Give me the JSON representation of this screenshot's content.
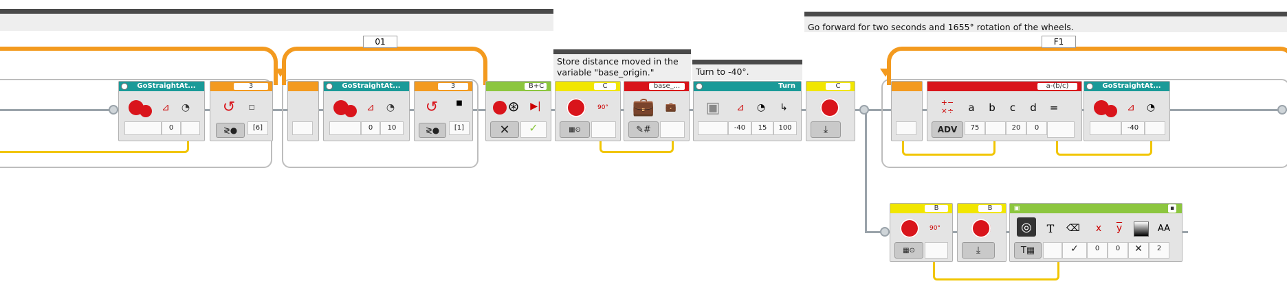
{
  "comments": {
    "c1": "",
    "c2": "Store distance moved in the variable \"base_origin.\"",
    "c3": "Turn to -40°.",
    "c4": "Go forward for two seconds and 1655° rotation of the wheels."
  },
  "loops": {
    "loop1_label": "01",
    "loop2_label": "F1"
  },
  "blocks": {
    "b1": {
      "title": "GoStraightAt...",
      "p1": "0"
    },
    "b2": {
      "title": "3",
      "p1": "[6]"
    },
    "b3": {
      "title": "GoStraightAt...",
      "p1": "0",
      "p2": "10"
    },
    "b4": {
      "title": "3",
      "p1": "[1]"
    },
    "b5": {
      "title": "B+C"
    },
    "b6": {
      "title": "C"
    },
    "b7": {
      "title": "base_..."
    },
    "b8": {
      "title": "Turn",
      "p1": "-40",
      "p2": "15",
      "p3": "100"
    },
    "b9": {
      "title": "C"
    },
    "b10": {
      "title": "a-(b/c)",
      "adv": "ADV",
      "a": "a",
      "b": "b",
      "c": "c",
      "d": "d",
      "eq": "=",
      "p1": "75",
      "p2": "20",
      "p3": "0"
    },
    "b11": {
      "title": "GoStraightAt...",
      "p1": "-40"
    },
    "b12": {
      "title": "B"
    },
    "b13": {
      "title": "B"
    },
    "b14": {
      "t": "T",
      "x": "x",
      "y": "y",
      "aa": "AA",
      "p1": "0",
      "p2": "0",
      "p3": "2"
    }
  },
  "colors": {
    "orange": "#f39a1f",
    "teal": "#1a9a98",
    "yellow": "#f1e600",
    "red": "#d9141b",
    "green": "#8cc63f",
    "wire_yellow": "#f1c500"
  },
  "icons": [
    "gear-icon",
    "motor-icon",
    "loop-icon",
    "steering-icon",
    "rotation-icon",
    "variable-icon",
    "math-icon",
    "display-icon",
    "download-icon"
  ]
}
